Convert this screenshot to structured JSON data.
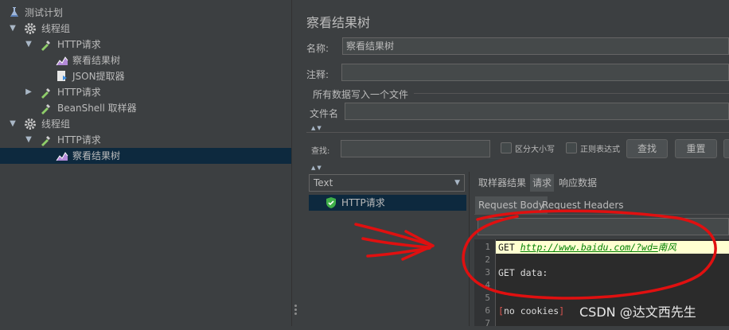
{
  "tree": {
    "items": [
      {
        "label": "测试计划",
        "icon": "flask-icon",
        "expanded": true
      },
      {
        "label": "线程组",
        "icon": "gear-icon",
        "expanded": true
      },
      {
        "label": "HTTP请求",
        "icon": "pipette-icon",
        "expanded": true
      },
      {
        "label": "察看结果树",
        "icon": "chart-icon"
      },
      {
        "label": "JSON提取器",
        "icon": "extractor-icon"
      },
      {
        "label": "HTTP请求",
        "icon": "pipette-icon",
        "expanded": false
      },
      {
        "label": "BeanShell 取样器",
        "icon": "pipette-icon"
      },
      {
        "label": "线程组",
        "icon": "gear-icon",
        "expanded": true
      },
      {
        "label": "HTTP请求",
        "icon": "pipette-icon",
        "expanded": true
      },
      {
        "label": "察看结果树",
        "icon": "chart-icon",
        "selected": true
      }
    ]
  },
  "panel": {
    "title": "察看结果树",
    "name_label": "名称:",
    "name_value": "察看结果树",
    "comment_label": "注释:",
    "comment_value": "",
    "file_group_label": "所有数据写入一个文件",
    "filename_label": "文件名",
    "filename_value": "",
    "search_label": "查找:",
    "search_value": "",
    "case_label": "区分大小写",
    "regex_label": "正则表达式",
    "find_button": "查找",
    "reset_button": "重置",
    "renderer_selected": "Text",
    "result_item": "HTTP请求",
    "tabs": [
      "取样器结果",
      "请求",
      "响应数据"
    ],
    "active_tab": "请求",
    "subtabs": [
      "Request Body",
      "Request Headers"
    ],
    "editor": {
      "line_numbers": [
        "1",
        "2",
        "3",
        "4",
        "5",
        "6",
        "7"
      ],
      "line1_method": "GET ",
      "line1_url": "http://www.baidu.com/?wd=",
      "line1_query": "南风",
      "line3": "GET data:",
      "line6_open": "[",
      "line6_text": "no cookies",
      "line6_close": "]"
    }
  },
  "watermark": "CSDN @达文西先生",
  "colors": {
    "background": "#3c3f41",
    "selection": "#0d293e",
    "annotation": "#e01010",
    "highlight_line": "#ffffd0"
  }
}
